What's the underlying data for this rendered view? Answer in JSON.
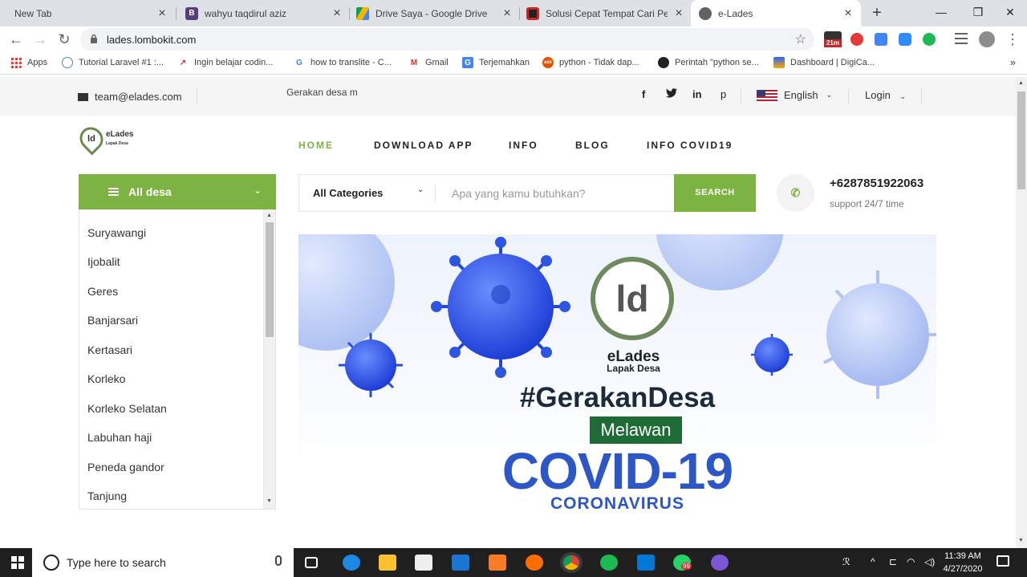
{
  "browser": {
    "tabs": [
      {
        "title": "New Tab",
        "icon": "none",
        "active": false
      },
      {
        "title": "wahyu taqdirul aziz",
        "icon": "bootstrap-icon",
        "active": false
      },
      {
        "title": "Drive Saya - Google Drive",
        "icon": "google-drive-icon",
        "active": false
      },
      {
        "title": "Solusi Cepat Tempat Cari Peng",
        "icon": "red-square-icon",
        "active": false
      },
      {
        "title": "e-Lades",
        "icon": "globe-icon",
        "active": true
      }
    ],
    "url": "lades.lombokit.com",
    "extension_badge": "21m",
    "bookmarks": [
      {
        "label": "Apps",
        "icon": "apps-grid-icon"
      },
      {
        "label": "Tutorial Laravel #1 :...",
        "icon": "laravel-icon"
      },
      {
        "label": "Ingin belajar codin...",
        "icon": "codepolitan-icon"
      },
      {
        "label": "how to translite - C...",
        "icon": "google-icon"
      },
      {
        "label": "Gmail",
        "icon": "gmail-icon"
      },
      {
        "label": "Terjemahkan",
        "icon": "translate-icon"
      },
      {
        "label": "python - Tidak dap...",
        "icon": "ask-icon"
      },
      {
        "label": "Perintah \"python se...",
        "icon": "github-icon"
      },
      {
        "label": "Dashboard | DigiCa...",
        "icon": "digicamp-icon"
      }
    ],
    "bookmarks_more": "»"
  },
  "topbar": {
    "email": "team@elades.com",
    "marquee": "Gerakan desa m",
    "social": [
      "f",
      "t",
      "in",
      "p"
    ],
    "language": "English",
    "login": "Login"
  },
  "header": {
    "logo_mark": "ld",
    "logo_title": "eLades",
    "logo_sub": "Lapak Desa",
    "nav": [
      "HOME",
      "DOWNLOAD APP",
      "INFO",
      "BLOG",
      "INFO COVID19"
    ],
    "accent": "#7cb342"
  },
  "sidebar": {
    "title": "All desa",
    "items": [
      "Suryawangi",
      "Ijobalit",
      "Geres",
      "Banjarsari",
      "Kertasari",
      "Korleko",
      "Korleko Selatan",
      "Labuhan haji",
      "Peneda gandor",
      "Tanjung"
    ]
  },
  "search": {
    "category": "All Categories",
    "placeholder": "Apa yang kamu butuhkan?",
    "button": "SEARCH"
  },
  "contact": {
    "phone": "+6287851922063",
    "support": "support 24/7 time"
  },
  "banner": {
    "logo_mark": "ld",
    "brand": "eLades",
    "brand_sub": "Lapak Desa",
    "tagline": "#GerakanDesa",
    "melawan": "Melawan",
    "covid": "COVID-19",
    "corona": "CORONAVIRUS"
  },
  "taskbar": {
    "search_placeholder": "Type here to search",
    "time": "11:39 AM",
    "date": "4/27/2020",
    "whatsapp_badge": "99"
  }
}
